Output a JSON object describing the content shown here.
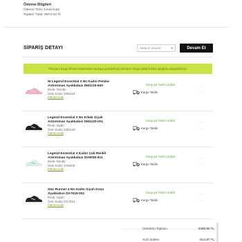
{
  "payment": {
    "title": "Ödeme Bilgileri",
    "type_line": "Ödeme Türü: Kredi Kartı",
    "total_line": "Toplam Tutar: 5874.93 TL"
  },
  "order": {
    "section_title": "SİPARİŞ DETAYI",
    "select_placeholder": "Aksiyon Seçiniz",
    "continue_label": "Devam Et",
    "banner": "Pleaserz kargo firması tarafından kargoya gönderilmiş ürünlerin kargo takip linkine aşağıda ulaşabilirsiniz.",
    "items": [
      {
        "name1": "W Legend Essential 3 Nn Kadın Pembe",
        "name2": "Antrenman Ayakkabısı DM1119-600",
        "color": "Renk: Pembe",
        "code": "Ürün Kodu: DM1119",
        "invoice": "Fatura Linki",
        "status": "Kargoya Teslim Edildi",
        "tracking": "Kargo Takibi",
        "shoe_color": "#e7b3c3"
      },
      {
        "name1": "Legend Essential 3 Nn Erkek Siyah",
        "name2": "Antrenman Ayakkabısı DM1120-001",
        "color": "Renk: Siyah",
        "code": "Ürün Kodu: DM1120",
        "invoice": "Fatura Linki",
        "status": "Kargoya Teslim Edildi",
        "tracking": "Kargo Takibi",
        "shoe_color": "#1d1d1d"
      },
      {
        "name1": "Legend Essential 3 Kadın Çok Renkli",
        "name2": "Antrenman Ayakkabısı DV5008-001",
        "color": "Renk: Renkli",
        "code": "Ürün Kodu: DV5008",
        "invoice": "Fatura Linki",
        "status": "Kargoya Teslim Edildi",
        "tracking": "Kargo Takibi",
        "shoe_color": "#cfe7e3"
      },
      {
        "name1": "Star Runner 4 Nn Kadın Siyah Koşu",
        "name2": "Ayakkabısı DX7615-001",
        "color": "Renk: Siyah",
        "code": "Ürün Kodu: DX7615",
        "invoice": "Fatura Linki",
        "status": "Kargoya Teslim Edildi",
        "tracking": "Kargo Takibi",
        "shoe_color": "#222222"
      }
    ]
  },
  "totals": {
    "subtotal_label": "Ürünlerin Toplamı",
    "subtotal_value": "6389.90 TL",
    "discount_label": "%10 İndirim",
    "discount_value": "-514.97 TL"
  }
}
